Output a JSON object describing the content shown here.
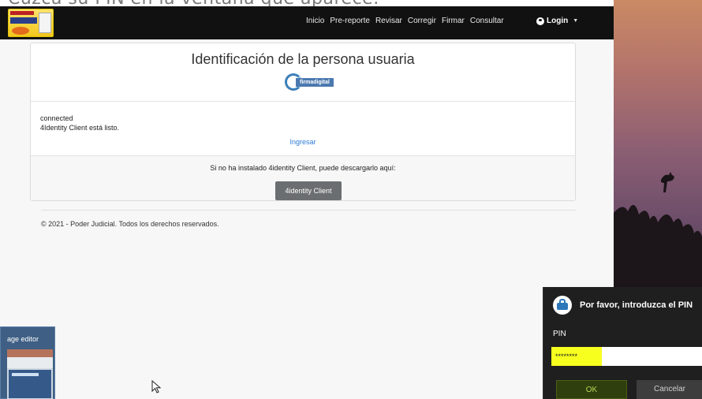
{
  "caption": {
    "text": "Cuzca su PIN en la ventana que aparece."
  },
  "navbar": {
    "links": [
      "Inicio",
      "Pre-reporte",
      "Revisar",
      "Corregir",
      "Firmar",
      "Consultar"
    ],
    "login_label": "Login"
  },
  "card": {
    "title": "Identificación de la persona usuaria",
    "logo_text": "firmadigital",
    "status_line1": "connected",
    "status_line2": "4Identity Client está listo.",
    "ingresar_label": "Ingresar",
    "download_text": "Si no ha instalado 4identity Client, puede descargarlo aquí:",
    "download_button": "4identity Client"
  },
  "footer": {
    "copyright": "© 2021 - Poder Judicial. Todos los derechos reservados."
  },
  "thumbnail": {
    "title": "age editor"
  },
  "pin_dialog": {
    "title": "Por favor, introduzca el PIN",
    "label": "PIN",
    "masked_value": "********",
    "ok_label": "OK",
    "cancel_label": "Cancelar"
  },
  "colors": {
    "navbar": "#111111",
    "link": "#2e7bd6",
    "pin_highlight": "#f7ff1f",
    "dialog_bg": "#1f1f1f"
  }
}
